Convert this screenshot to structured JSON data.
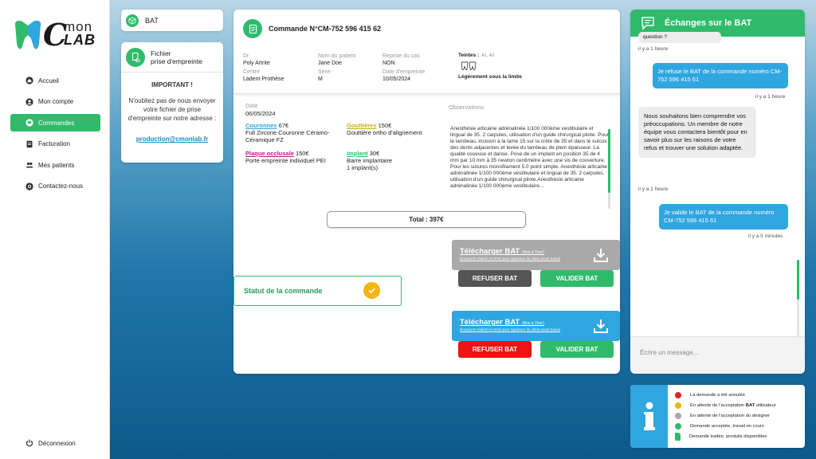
{
  "brand": {
    "logo_c": "C",
    "logo_mon": "mon",
    "logo_lab": "LAB"
  },
  "nav": [
    {
      "label": "Accueil",
      "icon": "home-icon"
    },
    {
      "label": "Mon compte",
      "icon": "user-icon"
    },
    {
      "label": "Commandes",
      "icon": "cart-icon",
      "active": true
    },
    {
      "label": "Facturation",
      "icon": "invoice-icon"
    },
    {
      "label": "Mes patients",
      "icon": "patients-icon"
    },
    {
      "label": "Contactez-nous",
      "icon": "at-icon"
    }
  ],
  "logout_label": "Déconnexion",
  "bat_card": {
    "label": "BAT"
  },
  "fichier_card": {
    "title_line1": "Fichier",
    "title_line2": "prise d'empreinte",
    "important": "IMPORTANT !",
    "message": "N'oubliez pas de nous envoyer votre fichier de prise d'empreinte sur notre adresse :",
    "email": "production@cmonlab.fr"
  },
  "order": {
    "title": "Commande N°CM-752 596 415 62",
    "dr_label": "Dr",
    "dr_value": "Poly Artrite",
    "patient_label": "Nom du patient",
    "patient_value": "Jane Doe",
    "reprise_label": "Reprise du cas",
    "reprise_value": "NON",
    "centre_label": "Centre",
    "centre_value": "Ladent Prothèse",
    "sexe_label": "Sexe",
    "sexe_value": "M",
    "date_empreinte_label": "Date d'empreinte",
    "date_empreinte_value": "10/05/2024",
    "teintes_label": "Teintes :",
    "teintes_codes": "A1, A2",
    "teintes_note": "Légèrement sous la limite",
    "date_label": "Date",
    "date_value": "06/05/2024",
    "couronnes_name": "Couronnes",
    "couronnes_price": " 67€",
    "couronnes_desc": "Full Zircone Couronne Céramo-Céramique FZ",
    "gouttieres_name": "Gouttières",
    "gouttieres_price": " 150€",
    "gouttieres_desc": "Gouttière ortho d'alignement",
    "plaque_name": "Plaque occlusale",
    "plaque_price": " 150€",
    "plaque_desc": "Porte empreinte individuel PEI",
    "implant_name": "Implant",
    "implant_price": " 30€",
    "implant_desc1": "Barre implantaire",
    "implant_desc2": "1 implant(s)",
    "observations_label": "Observations",
    "observations_text": "Anesthésie articaine adrénalinée 1/100 000ème vestibulaire et lingual de 35. 2 carpules, utilisation d'un guide chirurgical pilote. Pour le lambeau, incision à la lame 15 sur la crête de 35 et dans le sulcus des dents adjacentes et levée du lambeau de plein épaisseur. La qualité osseuse et danse. Pose de un implant en position 35 de 4 mm par 10 mm à 35 newton centimètre avec une vis de couverture. Pour les sutures monofilament 5.0 point simple. Anesthésie articaine adrénalinée 1/100 000ème vestibulaire et lingual de 35. 2 carpules, utilisation d'un guide chirurgical pilote.Anesthésie articaine adrénalinée 1/100 000ème vestibulaire...",
    "total": "Total : 397€"
  },
  "download1": {
    "title": "Télécharger BAT",
    "small": "(Bon à Tirer)",
    "sub": "Document réalisé et remis pour signature du client avant travail",
    "refuse": "REFUSER BAT",
    "validate": "VALIDER BAT"
  },
  "download2": {
    "title": "Télécharger BAT",
    "small": "(Bon à Tirer)",
    "sub": "Document réalisé et remis pour signature du client avant travail",
    "refuse": "REFUSER BAT",
    "validate": "VALIDER BAT"
  },
  "statut_label": "Statut de la commande",
  "chat": {
    "title": "Échanges sur le BAT",
    "partial_msg": "question ?",
    "t0": "il y a 1 heure",
    "msg1": "Je refuse le BAT de la commande numéro CM-752 596 415 61",
    "t1": "il y a 1 heure",
    "msg2": "Nous souhaitons bien comprendre vos préoccupations. Un membre de notre équipe vous contactera bientôt pour en savoir plus sur les raisons de votre refus et trouver une solution adaptée.",
    "t2": "il y a 1 heure",
    "msg3": "Je valide le BAT de la commande numéro CM-752 596 415 61",
    "t3": "il y a 5 minutes",
    "input_placeholder": "Écrire un message..."
  },
  "legend": [
    {
      "label": "La demande a été annulée",
      "color": "#e02424",
      "shape": "dot"
    },
    {
      "label_pre": "En attente de l'acceptation ",
      "label_bold": "BAT",
      "label_post": " utilisateur",
      "color": "#f5b50d",
      "shape": "dot"
    },
    {
      "label": "En attente de l'acceptation du designer",
      "color": "#a8a8a8",
      "shape": "dot"
    },
    {
      "label": "Demande acceptée, travail en cours",
      "color": "#2fbb6b",
      "shape": "dot"
    },
    {
      "label": "Demande traitée, produits disponibles",
      "color": "#2fbb6b",
      "shape": "doc"
    }
  ],
  "colors": {
    "accent": "#2fbb6b",
    "blue": "#2fa6e0",
    "grey_btn": "#555555",
    "red_btn": "#f01313",
    "green_btn": "#2fbb6b"
  }
}
